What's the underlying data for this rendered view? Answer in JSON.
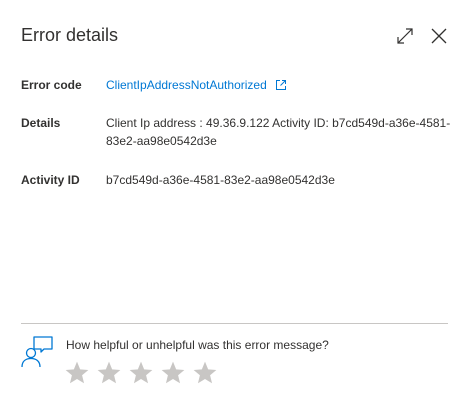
{
  "header": {
    "title": "Error details"
  },
  "rows": {
    "error_code_label": "Error code",
    "error_code_value": "ClientIpAddressNotAuthorized",
    "details_label": "Details",
    "details_value": "Client Ip address : 49.36.9.122 Activity ID: b7cd549d-a36e-4581-83e2-aa98e0542d3e",
    "activity_label": "Activity ID",
    "activity_value": "b7cd549d-a36e-4581-83e2-aa98e0542d3e"
  },
  "feedback": {
    "question": "How helpful or unhelpful was this error message?",
    "rating": 0,
    "max_rating": 5
  },
  "colors": {
    "link": "#0078d4",
    "text": "#323130",
    "star": "#c8c6c4",
    "icon_accent": "#0078d4"
  },
  "icons": {
    "maximize": "expand-icon",
    "close": "close-icon",
    "external": "external-link-icon",
    "feedback": "feedback-person-icon",
    "star": "star-icon"
  }
}
